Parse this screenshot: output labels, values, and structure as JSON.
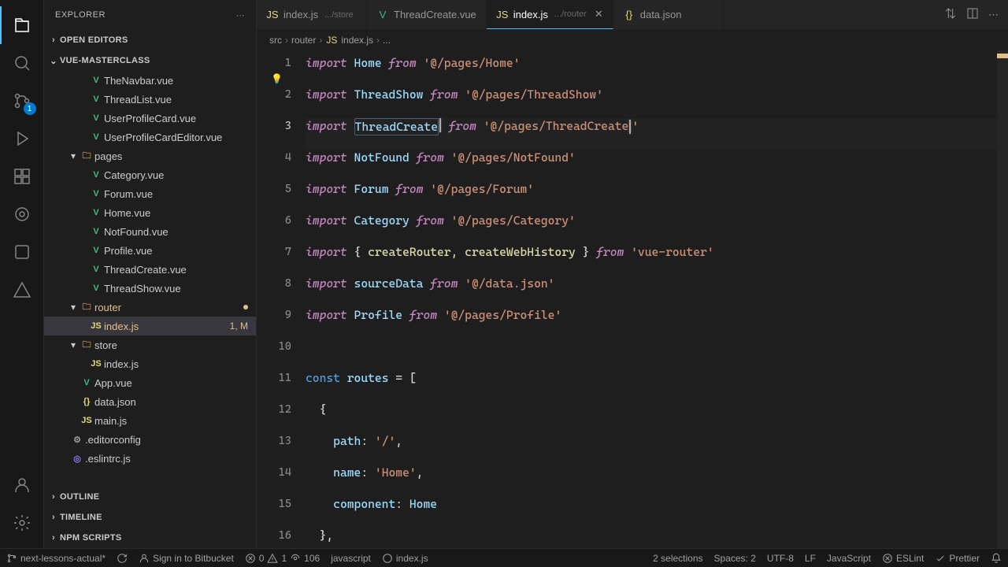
{
  "explorer": {
    "title": "EXPLORER",
    "sections": {
      "openEditors": "OPEN EDITORS",
      "workspace": "VUE-MASTERCLASS",
      "outline": "OUTLINE",
      "timeline": "TIMELINE",
      "npmScripts": "NPM SCRIPTS"
    },
    "files": [
      {
        "name": "TheNavbar.vue",
        "type": "vue",
        "indent": 3,
        "chev": ""
      },
      {
        "name": "ThreadList.vue",
        "type": "vue",
        "indent": 3,
        "chev": ""
      },
      {
        "name": "UserProfileCard.vue",
        "type": "vue",
        "indent": 3,
        "chev": ""
      },
      {
        "name": "UserProfileCardEditor.vue",
        "type": "vue",
        "indent": 3,
        "chev": ""
      },
      {
        "name": "pages",
        "type": "folder",
        "indent": 2,
        "chev": "▾",
        "color": "#c09553"
      },
      {
        "name": "Category.vue",
        "type": "vue",
        "indent": 3,
        "chev": ""
      },
      {
        "name": "Forum.vue",
        "type": "vue",
        "indent": 3,
        "chev": ""
      },
      {
        "name": "Home.vue",
        "type": "vue",
        "indent": 3,
        "chev": ""
      },
      {
        "name": "NotFound.vue",
        "type": "vue",
        "indent": 3,
        "chev": ""
      },
      {
        "name": "Profile.vue",
        "type": "vue",
        "indent": 3,
        "chev": ""
      },
      {
        "name": "ThreadCreate.vue",
        "type": "vue",
        "indent": 3,
        "chev": ""
      },
      {
        "name": "ThreadShow.vue",
        "type": "vue",
        "indent": 3,
        "chev": ""
      },
      {
        "name": "router",
        "type": "folder",
        "indent": 2,
        "chev": "▾",
        "mod": true
      },
      {
        "name": "index.js",
        "type": "js",
        "indent": 3,
        "chev": "",
        "selected": true,
        "badge": "1, M"
      },
      {
        "name": "store",
        "type": "folder-closed",
        "indent": 2,
        "chev": "▾"
      },
      {
        "name": "index.js",
        "type": "js",
        "indent": 3,
        "chev": ""
      },
      {
        "name": "App.vue",
        "type": "vue",
        "indent": 2,
        "chev": ""
      },
      {
        "name": "data.json",
        "type": "json",
        "indent": 2,
        "chev": ""
      },
      {
        "name": "main.js",
        "type": "js",
        "indent": 2,
        "chev": ""
      },
      {
        "name": ".editorconfig",
        "type": "editorconfig",
        "indent": 1,
        "chev": ""
      },
      {
        "name": ".eslintrc.js",
        "type": "eslint",
        "indent": 1,
        "chev": ""
      }
    ]
  },
  "tabs": [
    {
      "name": "index.js",
      "desc": ".../store",
      "type": "js",
      "active": false
    },
    {
      "name": "ThreadCreate.vue",
      "desc": "",
      "type": "vue",
      "active": false
    },
    {
      "name": "index.js",
      "desc": ".../router",
      "type": "js",
      "active": true
    },
    {
      "name": "data.json",
      "desc": "",
      "type": "json",
      "active": false
    }
  ],
  "breadcrumbs": [
    "src",
    "router",
    "index.js",
    "..."
  ],
  "scmBadge": "1",
  "code": {
    "lines": [
      {
        "n": 1,
        "type": "import",
        "id": "Home",
        "path": "@/pages/Home"
      },
      {
        "n": 2,
        "type": "import",
        "id": "ThreadShow",
        "path": "@/pages/ThreadShow"
      },
      {
        "n": 3,
        "type": "import",
        "id": "ThreadCreate",
        "path": "@/pages/ThreadCreate",
        "active": true
      },
      {
        "n": 4,
        "type": "import",
        "id": "NotFound",
        "path": "@/pages/NotFound"
      },
      {
        "n": 5,
        "type": "import",
        "id": "Forum",
        "path": "@/pages/Forum"
      },
      {
        "n": 6,
        "type": "import",
        "id": "Category",
        "path": "@/pages/Category"
      },
      {
        "n": 7,
        "type": "import-multi",
        "ids": "createRouter, createWebHistory",
        "path": "vue-router"
      },
      {
        "n": 8,
        "type": "import",
        "id": "sourceData",
        "path": "@/data.json"
      },
      {
        "n": 9,
        "type": "import",
        "id": "Profile",
        "path": "@/pages/Profile"
      },
      {
        "n": 10,
        "type": "blank"
      },
      {
        "n": 11,
        "type": "const-arr"
      },
      {
        "n": 12,
        "type": "brace-open"
      },
      {
        "n": 13,
        "type": "prop",
        "key": "path",
        "val": "'/'",
        "comma": true,
        "str": true
      },
      {
        "n": 14,
        "type": "prop",
        "key": "name",
        "val": "'Home'",
        "comma": true,
        "str": true
      },
      {
        "n": 15,
        "type": "prop",
        "key": "component",
        "val": "Home",
        "comma": false,
        "str": false
      },
      {
        "n": 16,
        "type": "brace-close"
      }
    ]
  },
  "status": {
    "branch": "next-lessons-actual*",
    "bitbucket": "Sign in to Bitbucket",
    "errors": "0",
    "warnings": "1",
    "radio": "106",
    "lang1": "javascript",
    "file": "index.js",
    "selections": "2 selections",
    "spaces": "Spaces: 2",
    "encoding": "UTF-8",
    "eol": "LF",
    "lang2": "JavaScript",
    "eslint": "ESLint",
    "prettier": "Prettier"
  }
}
